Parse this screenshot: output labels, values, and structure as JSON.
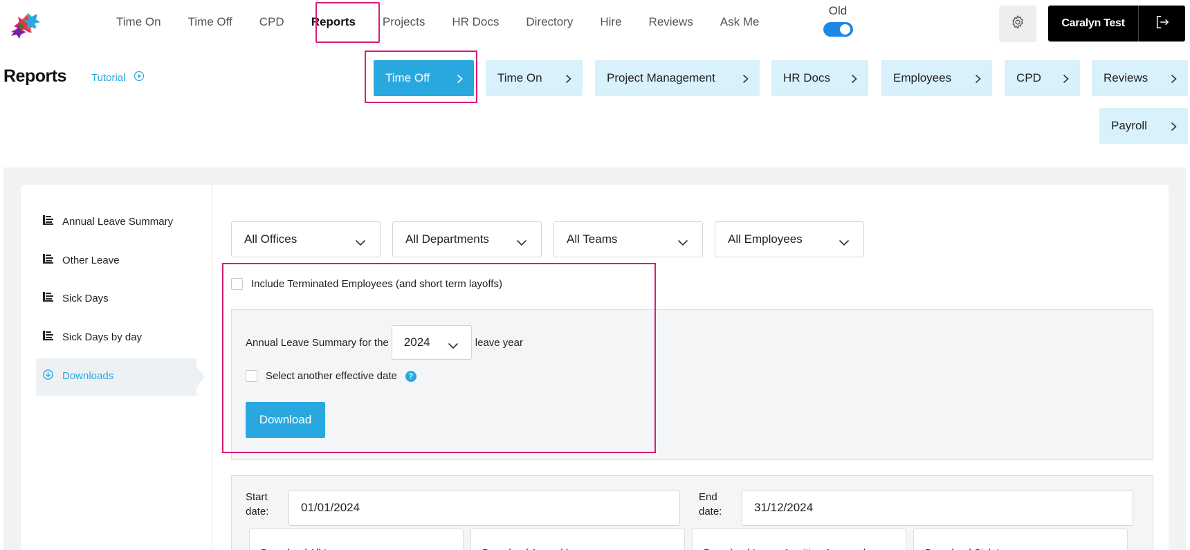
{
  "nav": {
    "items": [
      "Time On",
      "Time Off",
      "CPD",
      "Reports",
      "Projects",
      "HR Docs",
      "Directory",
      "Hire",
      "Reviews",
      "Ask Me"
    ],
    "active": "Reports",
    "toggle_label": "Old",
    "user_name": "Caralyn Test"
  },
  "header": {
    "title": "Reports",
    "tutorial": "Tutorial"
  },
  "report_tabs": [
    "Time Off",
    "Time On",
    "Project Management",
    "HR Docs",
    "Employees",
    "CPD",
    "Reviews",
    "Payroll"
  ],
  "active_tab": "Time Off",
  "sidebar": {
    "items": [
      "Annual Leave Summary",
      "Other Leave",
      "Sick Days",
      "Sick Days by day",
      "Downloads"
    ],
    "active": "Downloads"
  },
  "filters": [
    "All Offices",
    "All Departments",
    "All Teams",
    "All Employees"
  ],
  "include_terminated_label": "Include Terminated Employees (and short term layoffs)",
  "summary": {
    "prefix": "Annual Leave Summary for the",
    "year": "2024",
    "suffix": "leave year",
    "effective_date_label": "Select another effective date",
    "download_label": "Download"
  },
  "dates": {
    "start_label": "Start date:",
    "start_value": "01/01/2024",
    "end_label": "End date:",
    "end_value": "31/12/2024"
  },
  "download_cards": [
    "Download All Leave",
    "Download Annual leave",
    "Download Leave Awaiting Approval",
    "Download Sick Leave"
  ],
  "colors": {
    "accent": "#29a8e0",
    "tab_bg": "#d9f1fb",
    "highlight": "#d81b7a"
  }
}
